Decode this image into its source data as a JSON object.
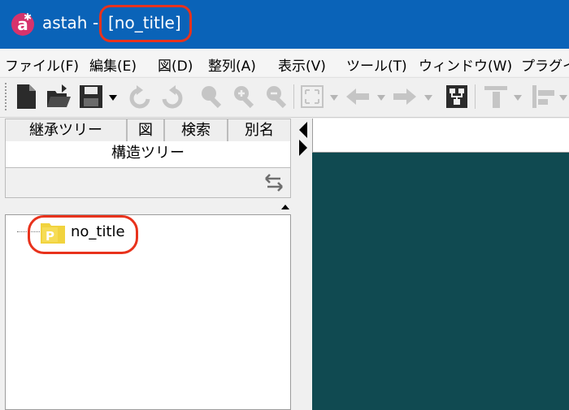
{
  "window": {
    "app_logo_letter": "a",
    "app_name": "astah",
    "separator": "-",
    "doc_title": "[no_title]"
  },
  "menubar": {
    "items": [
      {
        "label": "ファイル(F)"
      },
      {
        "label": "編集(E)"
      },
      {
        "label": "図(D)"
      },
      {
        "label": "整列(A)"
      },
      {
        "label": "表示(V)"
      },
      {
        "label": "ツール(T)"
      },
      {
        "label": "ウィンドウ(W)"
      },
      {
        "label": "プラグイ"
      }
    ]
  },
  "toolbar": {
    "icons": [
      "new-file-icon",
      "open-folder-icon",
      "save-icon",
      "undo-icon",
      "redo-icon",
      "zoom-icon",
      "zoom-in-icon",
      "zoom-out-icon",
      "fit-window-icon",
      "back-arrow-icon",
      "forward-arrow-icon",
      "tree-layout-icon",
      "align-top-icon",
      "align-left-icon"
    ]
  },
  "left_panel": {
    "tabs": [
      {
        "label": "継承ツリー"
      },
      {
        "label": "図"
      },
      {
        "label": "検索"
      },
      {
        "label": "別名"
      }
    ],
    "active_tab": "構造ツリー",
    "tree": {
      "root": {
        "label": "no_title",
        "icon_letter": "P"
      }
    }
  },
  "colors": {
    "titlebar": "#0a63b8",
    "highlight": "#e8321c",
    "canvas": "#104a51",
    "package_icon": "#f1d33e"
  }
}
